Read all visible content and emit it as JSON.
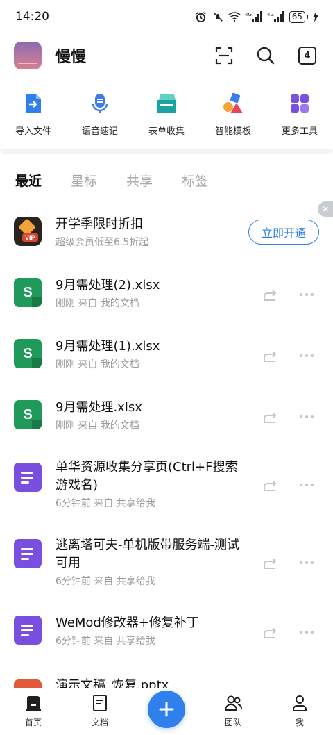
{
  "status_bar": {
    "time": "14:20",
    "battery": "65",
    "icons": [
      "alarm-icon",
      "mute-icon",
      "wifi-icon",
      "signal-4g-icon",
      "signal-4g-icon",
      "battery-icon",
      "charging-icon"
    ]
  },
  "header": {
    "username": "慢慢",
    "tab_count": "4",
    "icons": [
      "scan-icon",
      "search-icon",
      "tabs-icon"
    ]
  },
  "quick_actions": [
    {
      "label": "导入文件",
      "icon": "import-file-icon",
      "color": "#2f80ed"
    },
    {
      "label": "语音速记",
      "icon": "microphone-icon",
      "color": "#3d7bf0"
    },
    {
      "label": "表单收集",
      "icon": "form-collect-icon",
      "color": "#1aa3a3"
    },
    {
      "label": "智能模板",
      "icon": "template-shapes-icon",
      "color": "#f2a33a"
    },
    {
      "label": "更多工具",
      "icon": "grid-icon",
      "color": "#7a4fe0"
    }
  ],
  "tabs": [
    {
      "label": "最近",
      "active": true
    },
    {
      "label": "星标",
      "active": false
    },
    {
      "label": "共享",
      "active": false
    },
    {
      "label": "标签",
      "active": false
    }
  ],
  "promo": {
    "title": "开学季限时折扣",
    "subtitle": "超级会员低至6.5折起",
    "button": "立即开通",
    "badge": "VIP"
  },
  "files": [
    {
      "title": "9月需处理(2).xlsx",
      "meta": "刚刚  来自 我的文档",
      "type": "xlsx",
      "icon_letter": "S"
    },
    {
      "title": "9月需处理(1).xlsx",
      "meta": "刚刚  来自 我的文档",
      "type": "xlsx",
      "icon_letter": "S"
    },
    {
      "title": "9月需处理.xlsx",
      "meta": "刚刚  来自 我的文档",
      "type": "xlsx",
      "icon_letter": "S"
    },
    {
      "title": "单华资源收集分享页(Ctrl+F搜索游戏名)",
      "meta": "6分钟前  来自 共享给我",
      "type": "doc"
    },
    {
      "title": "逃离塔可夫-单机版带服务端-测试可用",
      "meta": "6分钟前  来自 共享给我",
      "type": "doc"
    },
    {
      "title": "WeMod修改器+修复补丁",
      "meta": "6分钟前  来自 共享给我",
      "type": "doc"
    }
  ],
  "peek_file": {
    "title": "演示文稿_恢复.pptx"
  },
  "bottom_nav": [
    {
      "label": "首页",
      "icon": "home-icon"
    },
    {
      "label": "文档",
      "icon": "document-icon"
    },
    {
      "label": "",
      "icon": "plus-icon"
    },
    {
      "label": "团队",
      "icon": "team-icon"
    },
    {
      "label": "我",
      "icon": "profile-icon"
    }
  ],
  "colors": {
    "accent": "#2f80ed",
    "xlsx": "#1f9a5a",
    "doc": "#7a4fe0",
    "muted": "#9a9a9a"
  }
}
